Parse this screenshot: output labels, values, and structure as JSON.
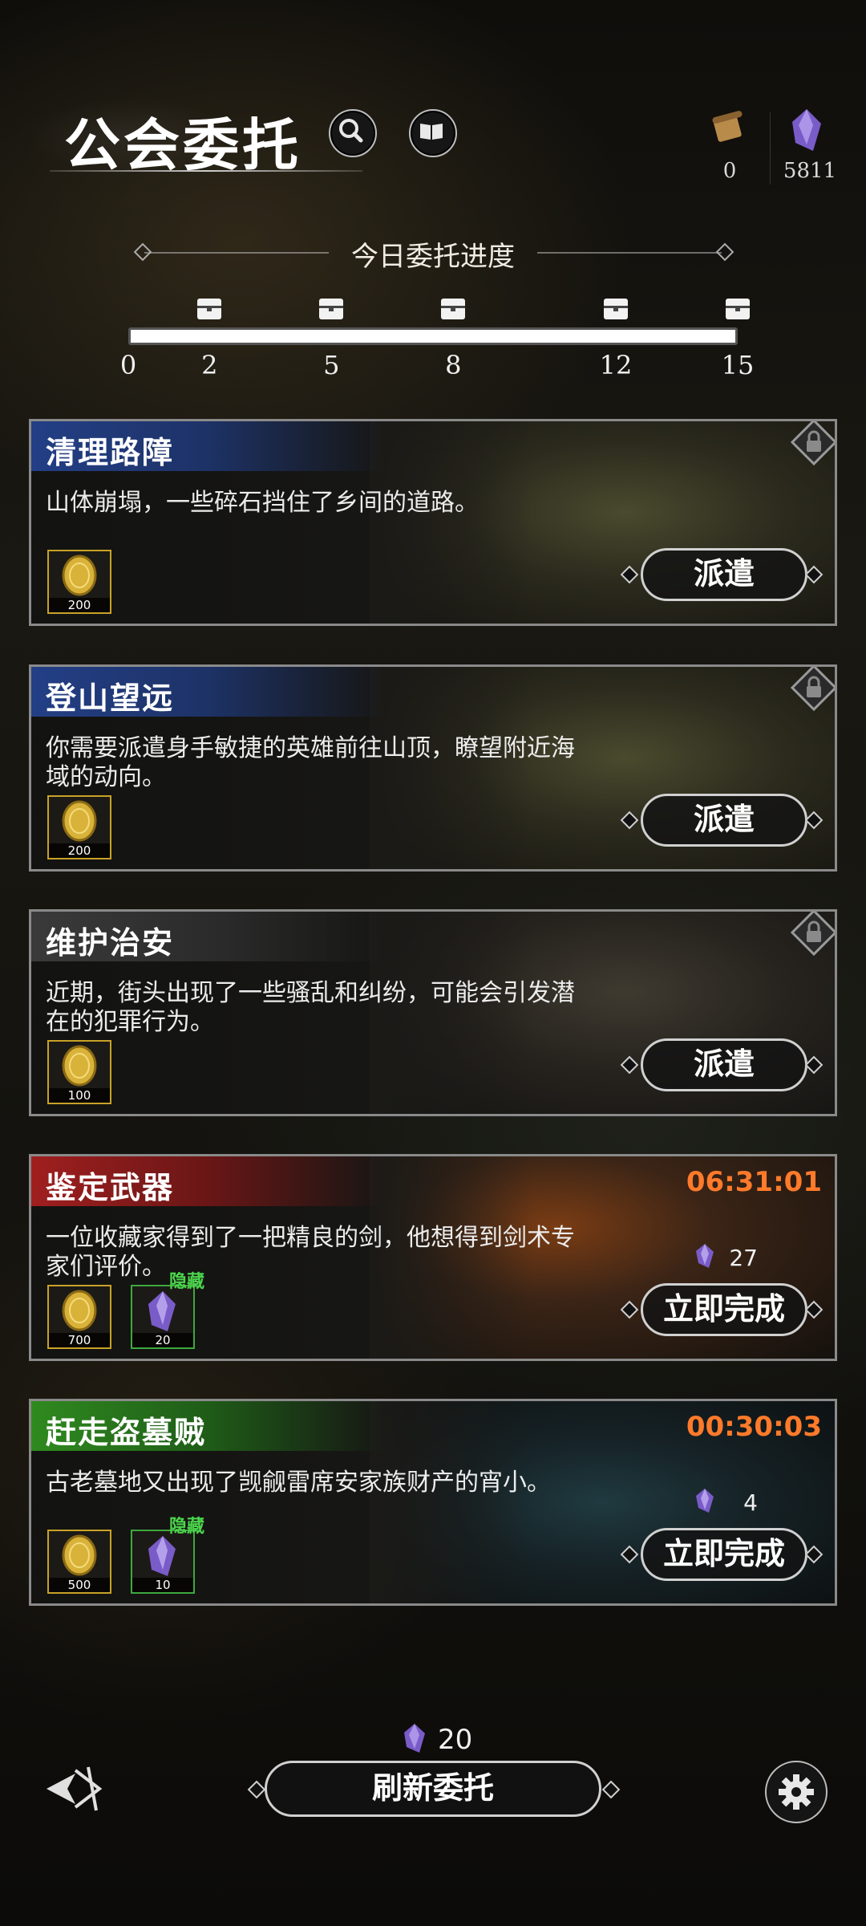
{
  "header": {
    "title": "公会委托",
    "resources": {
      "scroll_count": "0",
      "gem_count": "5811"
    }
  },
  "progress": {
    "title": "今日委托进度",
    "start_label": "0",
    "milestones": [
      "2",
      "5",
      "8",
      "12",
      "15"
    ],
    "fill_fraction": 1.0
  },
  "quests": [
    {
      "title": "清理路障",
      "description": "山体崩塌，一些碎石挡住了乡间的道路。",
      "theme": "blue",
      "locked": true,
      "rewards": [
        {
          "type": "gold",
          "amount": "200"
        }
      ],
      "action": "派遣"
    },
    {
      "title": "登山望远",
      "description": "你需要派遣身手敏捷的英雄前往山顶，瞭望附近海域的动向。",
      "theme": "blue",
      "locked": true,
      "rewards": [
        {
          "type": "gold",
          "amount": "200"
        }
      ],
      "action": "派遣"
    },
    {
      "title": "维护治安",
      "description": "近期，街头出现了一些骚乱和纠纷，可能会引发潜在的犯罪行为。",
      "theme": "gray",
      "locked": true,
      "rewards": [
        {
          "type": "gold",
          "amount": "100"
        }
      ],
      "action": "派遣"
    },
    {
      "title": "鉴定武器",
      "description": "一位收藏家得到了一把精良的剑，他想得到剑术专家们评价。",
      "theme": "red",
      "timer": "06:31:01",
      "cost": "27",
      "rewards": [
        {
          "type": "gold",
          "amount": "700"
        },
        {
          "type": "gem",
          "amount": "20",
          "tag": "隐藏"
        }
      ],
      "action": "立即完成"
    },
    {
      "title": "赶走盗墓贼",
      "description": "古老墓地又出现了觊觎雷席安家族财产的宵小。",
      "theme": "green",
      "timer": "00:30:03",
      "cost": "4",
      "rewards": [
        {
          "type": "gold",
          "amount": "500"
        },
        {
          "type": "gem",
          "amount": "10",
          "tag": "隐藏"
        }
      ],
      "action": "立即完成"
    }
  ],
  "footer": {
    "refresh_cost": "20",
    "refresh_label": "刷新委托"
  },
  "colors": {
    "timer": "#ff7a2a",
    "hidden_tag": "#4cd64c",
    "blue_header": "#1e3a78",
    "red_header": "#8a1c1c",
    "green_header": "#2e7a1e"
  }
}
